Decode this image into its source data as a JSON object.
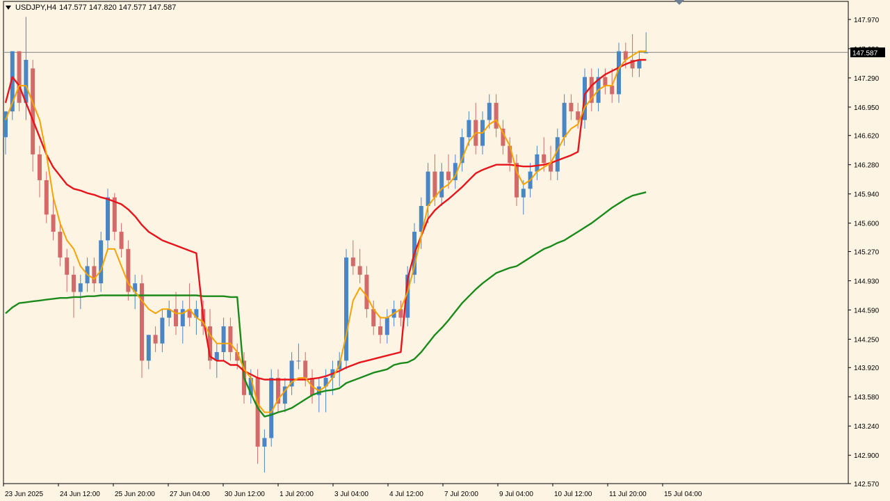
{
  "header": {
    "symbol": "USDJPY,H4",
    "ohlc": "147.577 147.820 147.577 147.587"
  },
  "colors": {
    "background": "#fdf4e3",
    "bull": "#4a86c5",
    "bear": "#d26a6a",
    "ma_fast": "#f5a300",
    "ma_mid": "#e8141b",
    "ma_slow": "#1b8a1b",
    "grid_line": "#808080",
    "price_tag_bg": "#000000"
  },
  "chart_data": {
    "type": "candlestick",
    "symbol": "USDJPY",
    "timeframe": "H4",
    "ylim": [
      142.57,
      148.18
    ],
    "y_ticks": [
      "147.970",
      "147.630",
      "147.290",
      "146.950",
      "146.620",
      "146.280",
      "145.940",
      "145.600",
      "145.270",
      "144.930",
      "144.590",
      "144.250",
      "143.920",
      "143.580",
      "143.240",
      "142.900",
      "142.570"
    ],
    "x_ticks": [
      "23 Jun 2025",
      "24 Jun 12:00",
      "25 Jun 20:00",
      "27 Jun 04:00",
      "30 Jun 12:00",
      "1 Jul 20:00",
      "3 Jul 04:00",
      "4 Jul 12:00",
      "7 Jul 20:00",
      "9 Jul 04:00",
      "10 Jul 12:00",
      "11 Jul 20:00",
      "15 Jul 04:00"
    ],
    "current_price": "147.587",
    "candles": [
      [
        146.6,
        146.9,
        146.4,
        146.9
      ],
      [
        146.9,
        147.6,
        146.8,
        147.6
      ],
      [
        147.6,
        147.6,
        146.9,
        147.0
      ],
      [
        147.0,
        148.0,
        146.8,
        147.5
      ],
      [
        147.4,
        147.5,
        146.2,
        146.4
      ],
      [
        146.4,
        146.5,
        145.9,
        146.1
      ],
      [
        146.1,
        146.2,
        145.6,
        145.7
      ],
      [
        145.7,
        145.9,
        145.4,
        145.5
      ],
      [
        145.5,
        145.6,
        145.1,
        145.2
      ],
      [
        145.2,
        145.3,
        144.8,
        145.0
      ],
      [
        145.0,
        145.1,
        144.5,
        144.8
      ],
      [
        144.8,
        145.0,
        144.6,
        144.9
      ],
      [
        144.9,
        145.2,
        144.8,
        145.1
      ],
      [
        145.1,
        145.2,
        144.8,
        144.9
      ],
      [
        144.9,
        145.5,
        144.8,
        145.4
      ],
      [
        145.4,
        146.0,
        145.3,
        145.9
      ],
      [
        145.9,
        145.95,
        145.4,
        145.5
      ],
      [
        145.5,
        145.6,
        145.2,
        145.3
      ],
      [
        145.3,
        145.4,
        144.7,
        144.8
      ],
      [
        144.8,
        145.0,
        144.6,
        144.9
      ],
      [
        144.9,
        145.0,
        143.8,
        144.0
      ],
      [
        144.0,
        144.3,
        143.9,
        144.3
      ],
      [
        144.3,
        144.4,
        144.1,
        144.2
      ],
      [
        144.2,
        144.6,
        144.1,
        144.5
      ],
      [
        144.5,
        144.7,
        144.4,
        144.6
      ],
      [
        144.6,
        144.8,
        144.3,
        144.4
      ],
      [
        144.4,
        144.7,
        144.2,
        144.6
      ],
      [
        144.6,
        144.9,
        144.4,
        144.5
      ],
      [
        144.5,
        144.7,
        144.3,
        144.6
      ],
      [
        144.6,
        144.7,
        144.3,
        144.4
      ],
      [
        144.4,
        144.6,
        143.9,
        144.0
      ],
      [
        144.0,
        144.2,
        143.8,
        144.1
      ],
      [
        144.1,
        144.5,
        144.0,
        144.4
      ],
      [
        144.4,
        144.5,
        144.0,
        144.1
      ],
      [
        144.1,
        144.2,
        143.9,
        144.0
      ],
      [
        144.0,
        144.1,
        143.5,
        143.6
      ],
      [
        143.6,
        143.9,
        143.5,
        143.8
      ],
      [
        143.8,
        143.9,
        142.8,
        143.0
      ],
      [
        143.0,
        143.2,
        142.7,
        143.1
      ],
      [
        143.1,
        143.9,
        143.0,
        143.8
      ],
      [
        143.8,
        143.9,
        143.4,
        143.5
      ],
      [
        143.5,
        143.8,
        143.4,
        143.7
      ],
      [
        143.7,
        144.1,
        143.6,
        144.0
      ],
      [
        144.0,
        144.2,
        143.9,
        144.0
      ],
      [
        144.0,
        144.1,
        143.7,
        143.8
      ],
      [
        143.8,
        143.9,
        143.5,
        143.6
      ],
      [
        143.6,
        143.8,
        143.4,
        143.7
      ],
      [
        143.7,
        143.9,
        143.4,
        143.8
      ],
      [
        143.8,
        144.0,
        143.6,
        143.9
      ],
      [
        143.9,
        144.1,
        143.7,
        144.0
      ],
      [
        144.0,
        145.3,
        143.9,
        145.2
      ],
      [
        145.2,
        145.4,
        145.0,
        145.1
      ],
      [
        145.1,
        145.3,
        144.9,
        145.0
      ],
      [
        145.0,
        145.1,
        144.5,
        144.6
      ],
      [
        144.6,
        144.7,
        144.3,
        144.4
      ],
      [
        144.4,
        144.5,
        144.2,
        144.3
      ],
      [
        144.3,
        144.6,
        144.2,
        144.5
      ],
      [
        144.5,
        144.7,
        144.4,
        144.6
      ],
      [
        144.6,
        144.7,
        144.4,
        144.5
      ],
      [
        144.5,
        145.1,
        144.4,
        145.0
      ],
      [
        145.0,
        145.6,
        144.9,
        145.5
      ],
      [
        145.5,
        145.9,
        145.3,
        145.8
      ],
      [
        145.8,
        146.3,
        145.6,
        146.2
      ],
      [
        146.2,
        146.4,
        145.8,
        145.9
      ],
      [
        145.9,
        146.3,
        145.8,
        146.2
      ],
      [
        146.2,
        146.4,
        146.0,
        146.1
      ],
      [
        146.1,
        146.4,
        146.0,
        146.3
      ],
      [
        146.3,
        146.7,
        146.2,
        146.6
      ],
      [
        146.6,
        146.9,
        146.5,
        146.8
      ],
      [
        146.8,
        147.0,
        146.4,
        146.5
      ],
      [
        146.5,
        146.9,
        146.4,
        146.8
      ],
      [
        146.8,
        147.1,
        146.7,
        147.0
      ],
      [
        147.0,
        147.1,
        146.6,
        146.7
      ],
      [
        146.7,
        146.8,
        146.4,
        146.5
      ],
      [
        146.5,
        146.6,
        146.2,
        146.3
      ],
      [
        146.3,
        146.4,
        145.8,
        145.9
      ],
      [
        145.9,
        146.1,
        145.7,
        146.0
      ],
      [
        146.0,
        146.3,
        145.9,
        146.2
      ],
      [
        146.2,
        146.5,
        146.1,
        146.4
      ],
      [
        146.4,
        146.6,
        146.2,
        146.3
      ],
      [
        146.3,
        146.5,
        146.1,
        146.2
      ],
      [
        146.2,
        146.7,
        146.1,
        146.6
      ],
      [
        146.6,
        147.1,
        146.5,
        147.0
      ],
      [
        147.0,
        147.1,
        146.8,
        146.9
      ],
      [
        146.9,
        147.0,
        146.7,
        146.8
      ],
      [
        146.8,
        147.4,
        146.7,
        147.3
      ],
      [
        147.3,
        147.4,
        146.9,
        147.0
      ],
      [
        147.0,
        147.4,
        146.9,
        147.3
      ],
      [
        147.3,
        147.4,
        147.1,
        147.2
      ],
      [
        147.2,
        147.4,
        147.0,
        147.1
      ],
      [
        147.1,
        147.7,
        147.0,
        147.6
      ],
      [
        147.6,
        147.7,
        147.4,
        147.5
      ],
      [
        147.5,
        147.8,
        147.3,
        147.4
      ],
      [
        147.4,
        147.6,
        147.3,
        147.5
      ],
      [
        147.577,
        147.82,
        147.577,
        147.587
      ]
    ],
    "ma_fast": [
      146.8,
      147.0,
      147.2,
      147.2,
      147.0,
      146.8,
      146.4,
      145.9,
      145.6,
      145.4,
      145.3,
      145.1,
      145.0,
      144.95,
      145.05,
      145.3,
      145.3,
      145.1,
      144.9,
      144.8,
      144.7,
      144.6,
      144.55,
      144.6,
      144.6,
      144.55,
      144.55,
      144.6,
      144.5,
      144.45,
      144.3,
      144.2,
      144.2,
      144.2,
      144.1,
      143.9,
      143.8,
      143.5,
      143.4,
      143.4,
      143.55,
      143.65,
      143.75,
      143.8,
      143.8,
      143.7,
      143.65,
      143.7,
      143.8,
      143.95,
      144.3,
      144.7,
      144.85,
      144.75,
      144.6,
      144.5,
      144.5,
      144.55,
      144.6,
      144.8,
      145.1,
      145.45,
      145.8,
      145.9,
      146.0,
      146.05,
      146.15,
      146.35,
      146.55,
      146.65,
      146.65,
      146.75,
      146.8,
      146.65,
      146.5,
      146.2,
      146.05,
      146.1,
      146.2,
      146.25,
      146.3,
      146.45,
      146.6,
      146.7,
      146.75,
      146.95,
      147.05,
      147.15,
      147.2,
      147.2,
      147.4,
      147.5,
      147.55,
      147.6,
      147.6
    ],
    "ma_mid": [
      147.0,
      147.3,
      147.2,
      147.0,
      146.8,
      146.6,
      146.4,
      146.25,
      146.15,
      146.05,
      146.0,
      145.98,
      145.95,
      145.93,
      145.9,
      145.88,
      145.85,
      145.82,
      145.76,
      145.68,
      145.58,
      145.5,
      145.45,
      145.4,
      145.37,
      145.34,
      145.31,
      145.28,
      145.25,
      144.5,
      144.05,
      144.0,
      144.0,
      143.95,
      143.95,
      143.88,
      143.84,
      143.8,
      143.78,
      143.78,
      143.78,
      143.78,
      143.78,
      143.78,
      143.78,
      143.79,
      143.8,
      143.82,
      143.85,
      143.88,
      143.92,
      143.95,
      143.98,
      144.0,
      144.02,
      144.04,
      144.06,
      144.08,
      144.1,
      144.95,
      145.25,
      145.45,
      145.65,
      145.75,
      145.82,
      145.88,
      145.95,
      146.02,
      146.1,
      146.18,
      146.22,
      146.25,
      146.28,
      146.28,
      146.28,
      146.27,
      146.26,
      146.26,
      146.27,
      146.28,
      146.3,
      146.33,
      146.36,
      146.39,
      146.43,
      147.1,
      147.2,
      147.27,
      147.33,
      147.37,
      147.41,
      147.45,
      147.48,
      147.5,
      147.5
    ],
    "ma_slow": [
      144.55,
      144.62,
      144.67,
      144.68,
      144.69,
      144.7,
      144.71,
      144.72,
      144.73,
      144.73,
      144.74,
      144.74,
      144.75,
      144.75,
      144.76,
      144.76,
      144.76,
      144.76,
      144.76,
      144.76,
      144.76,
      144.76,
      144.76,
      144.76,
      144.76,
      144.76,
      144.76,
      144.76,
      144.76,
      144.75,
      144.75,
      144.75,
      144.75,
      144.74,
      144.74,
      143.8,
      143.62,
      143.45,
      143.35,
      143.37,
      143.4,
      143.42,
      143.45,
      143.5,
      143.55,
      143.6,
      143.63,
      143.65,
      143.66,
      143.68,
      143.74,
      143.77,
      143.8,
      143.83,
      143.86,
      143.88,
      143.9,
      143.95,
      143.97,
      143.98,
      144.02,
      144.1,
      144.2,
      144.3,
      144.38,
      144.47,
      144.57,
      144.67,
      144.75,
      144.83,
      144.9,
      144.96,
      145.02,
      145.05,
      145.08,
      145.1,
      145.15,
      145.2,
      145.25,
      145.3,
      145.33,
      145.37,
      145.4,
      145.45,
      145.5,
      145.55,
      145.6,
      145.66,
      145.72,
      145.78,
      145.83,
      145.88,
      145.92,
      145.94,
      145.96
    ]
  }
}
